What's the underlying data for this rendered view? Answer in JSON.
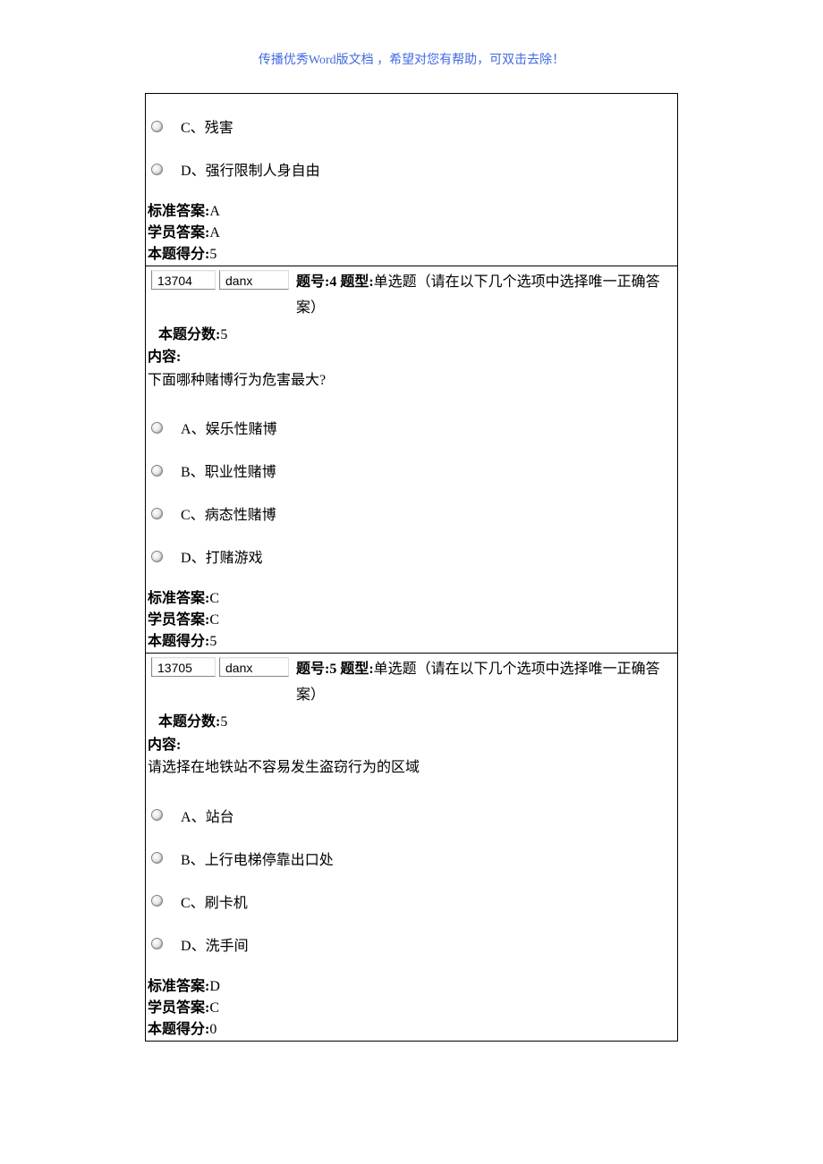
{
  "page_header": "传播优秀Word版文档 ，希望对您有帮助，可双击去除！",
  "q3": {
    "options": [
      {
        "letter": "C",
        "text": "残害"
      },
      {
        "letter": "D",
        "text": "强行限制人身自由"
      }
    ],
    "std_answer_label": "标准答案:",
    "std_answer": "A",
    "stu_answer_label": "学员答案:",
    "stu_answer": "A",
    "score_label": "本题得分:",
    "score": "5"
  },
  "q4": {
    "id": "13704",
    "type": "danx",
    "header_prefix": "题号:4  题型:",
    "header_type": "单选题（请在以下几个选项中选择唯一正确答案）",
    "header_score_label": "本题分数:",
    "header_score": "5",
    "content_label": "内容:",
    "question_text": "下面哪种赌博行为危害最大?",
    "options": [
      {
        "letter": "A",
        "text": "娱乐性赌博"
      },
      {
        "letter": "B",
        "text": "职业性赌博"
      },
      {
        "letter": "C",
        "text": "病态性赌博"
      },
      {
        "letter": "D",
        "text": "打赌游戏"
      }
    ],
    "std_answer_label": "标准答案:",
    "std_answer": "C",
    "stu_answer_label": "学员答案:",
    "stu_answer": "C",
    "score_label": "本题得分:",
    "score": "5"
  },
  "q5": {
    "id": "13705",
    "type": "danx",
    "header_prefix": "题号:5  题型:",
    "header_type": "单选题（请在以下几个选项中选择唯一正确答案）",
    "header_score_label": "本题分数:",
    "header_score": "5",
    "content_label": "内容:",
    "question_text": "请选择在地铁站不容易发生盗窃行为的区域",
    "options": [
      {
        "letter": "A",
        "text": "站台"
      },
      {
        "letter": "B",
        "text": "上行电梯停靠出口处"
      },
      {
        "letter": "C",
        "text": "刷卡机"
      },
      {
        "letter": "D",
        "text": "洗手间"
      }
    ],
    "std_answer_label": "标准答案:",
    "std_answer": "D",
    "stu_answer_label": "学员答案:",
    "stu_answer": "C",
    "score_label": "本题得分:",
    "score": "0"
  }
}
